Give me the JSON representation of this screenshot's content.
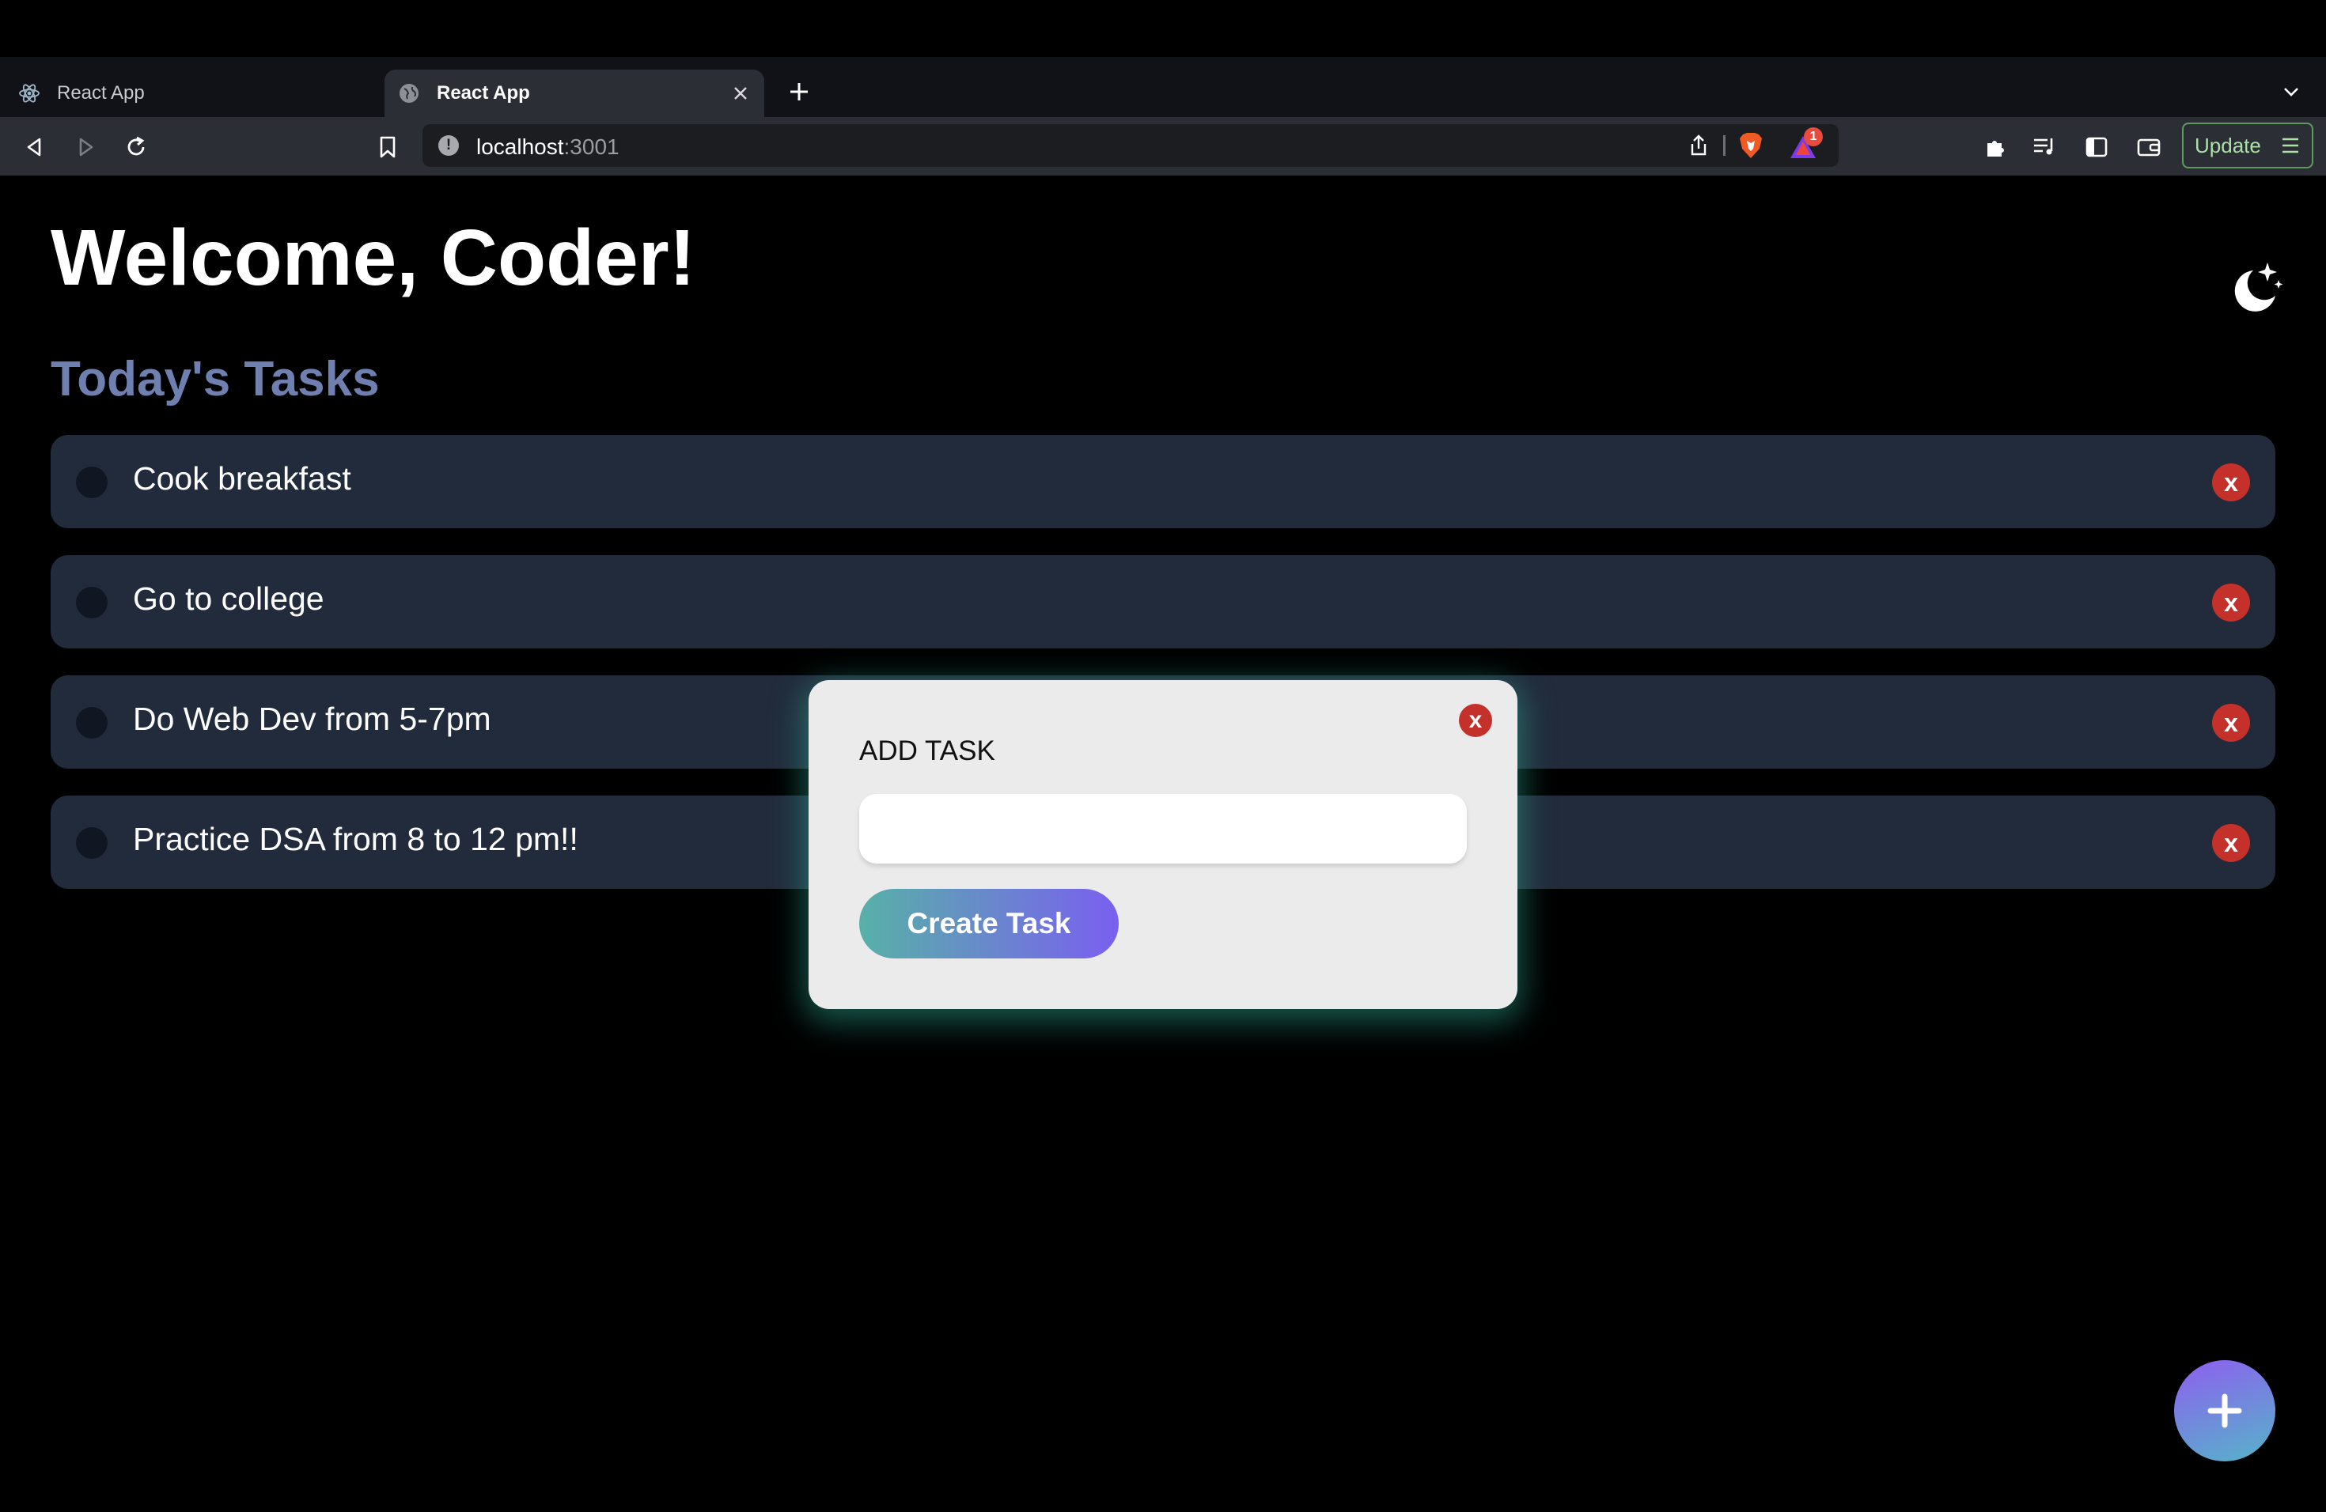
{
  "browser": {
    "tabs": [
      {
        "title": "React App",
        "active": false
      },
      {
        "title": "React App",
        "active": true
      }
    ],
    "url": {
      "host": "localhost",
      "port": ":3001"
    },
    "rewards_badge": "1",
    "update_label": "Update"
  },
  "page": {
    "title": "Welcome, Coder!",
    "section_title": "Today's Tasks",
    "tasks": [
      {
        "label": "Cook breakfast",
        "delete_label": "x"
      },
      {
        "label": "Go to college",
        "delete_label": "x"
      },
      {
        "label": "Do Web Dev from 5-7pm",
        "delete_label": "x"
      },
      {
        "label": "Practice DSA from 8 to 12 pm!!",
        "delete_label": "x"
      }
    ]
  },
  "modal": {
    "title": "ADD TASK",
    "close_label": "x",
    "input_value": "",
    "create_label": "Create Task"
  },
  "colors": {
    "background": "#000000",
    "task_card": "#222b3b",
    "section_title": "#6f7fb0",
    "delete_red": "#c4312a",
    "gradient_start": "#57b1a7",
    "gradient_end": "#7a5ff0"
  },
  "icons": {
    "theme_toggle": "moon-stars-icon",
    "fab": "plus-icon"
  }
}
